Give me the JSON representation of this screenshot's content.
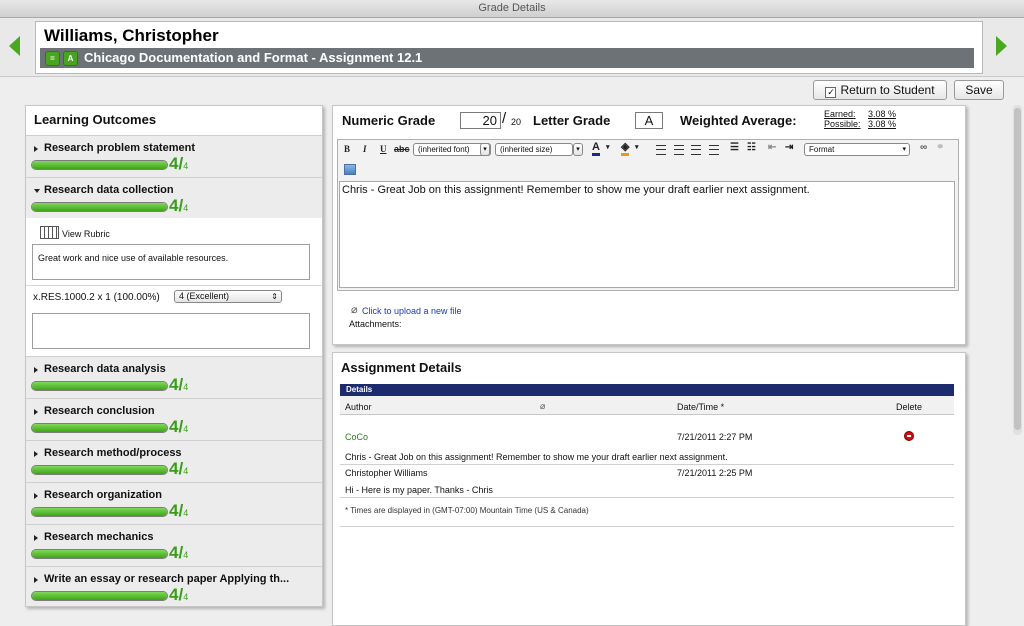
{
  "window": {
    "title": "Grade Details"
  },
  "header": {
    "student_name": "Williams, Christopher",
    "badge1": "=",
    "badge2": "A",
    "assignment_title": "Chicago Documentation and Format - Assignment 12.1"
  },
  "toolbar": {
    "return_label": "Return to Student",
    "return_checked": "✓",
    "save_label": "Save"
  },
  "learning_outcomes": {
    "title": "Learning Outcomes",
    "items": [
      {
        "name": "Research problem statement",
        "score": "4",
        "max": "4",
        "progress": 1.0
      },
      {
        "name": "Research data collection",
        "score": "4",
        "max": "4",
        "progress": 1.0
      },
      {
        "name": "Research data analysis",
        "score": "4",
        "max": "4",
        "progress": 1.0
      },
      {
        "name": "Research conclusion",
        "score": "4",
        "max": "4",
        "progress": 1.0
      },
      {
        "name": "Research method/process",
        "score": "4",
        "max": "4",
        "progress": 1.0
      },
      {
        "name": "Research organization",
        "score": "4",
        "max": "4",
        "progress": 1.0
      },
      {
        "name": "Research mechanics",
        "score": "4",
        "max": "4",
        "progress": 1.0
      },
      {
        "name": "Write an essay or research paper Applying th...",
        "score": "4",
        "max": "4",
        "progress": 1.0
      }
    ],
    "expanded": {
      "view_rubric": "View Rubric",
      "comment": "Great work and nice use of available resources.",
      "criterion": "x.RES.1000.2 x 1 (100.00%)",
      "level_selected": "4 (Excellent)",
      "second_comment": ""
    }
  },
  "grading": {
    "numeric_label": "Numeric Grade",
    "numeric_value": "20",
    "numeric_slash": "/",
    "numeric_max": "20",
    "letter_label": "Letter Grade",
    "letter_value": "A",
    "weighted_label": "Weighted Average:",
    "earned_label": "Earned:",
    "earned_value": "3.08 %",
    "possible_label": "Possible:",
    "possible_value": "3.08 %"
  },
  "editor": {
    "bold": "B",
    "italic": "I",
    "underline": "U",
    "strike": "abc",
    "font_select": "(inherited font)",
    "size_select": "(inherited size)",
    "text_color": "A",
    "format_select": "Format",
    "content": "Chris - Great Job on this assignment! Remember to show me your draft earlier next assignment.",
    "upload_link": "Click to upload a new file",
    "attachments_label": "Attachments:"
  },
  "assignment_details": {
    "title": "Assignment Details",
    "table_header": "Details",
    "col_author": "Author",
    "col_datetime": "Date/Time *",
    "col_delete": "Delete",
    "entries": [
      {
        "author": "CoCo",
        "datetime": "7/21/2011 2:27 PM",
        "text": "Chris - Great Job on this assignment! Remember to show me your draft earlier next assignment."
      },
      {
        "author": "Christopher Williams",
        "datetime": "7/21/2011 2:25 PM",
        "text": "Hi - Here is my paper. Thanks - Chris"
      }
    ],
    "timezone_note": "* Times are displayed in (GMT-07:00) Mountain Time (US & Canada)"
  },
  "colors": {
    "accent_green": "#3ea516",
    "details_header": "#1c2a6e",
    "assignment_bar": "#6d7276",
    "author_coco": "#2e7d1a"
  }
}
